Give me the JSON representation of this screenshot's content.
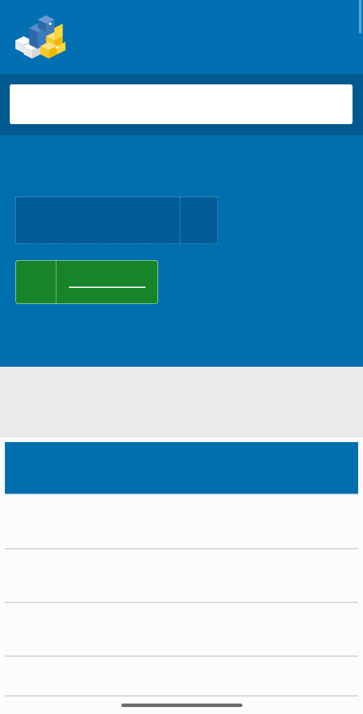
{
  "header": {
    "logo_icon": "python-package-cubes-logo",
    "background_color": "#0070b2"
  },
  "search": {
    "value": "",
    "placeholder": "",
    "band_color": "#005a90"
  },
  "hero": {
    "background_color": "#006fb0",
    "field_value": "",
    "field_button_label": "",
    "cta_label": "",
    "cta_color": "#18842a"
  },
  "grey_band": {
    "text": "",
    "background_color": "#eaeaea"
  },
  "list": {
    "header_label": "",
    "header_color": "#006fb0",
    "rows": [
      {
        "label": ""
      },
      {
        "label": ""
      },
      {
        "label": ""
      },
      {
        "label": ""
      }
    ]
  }
}
